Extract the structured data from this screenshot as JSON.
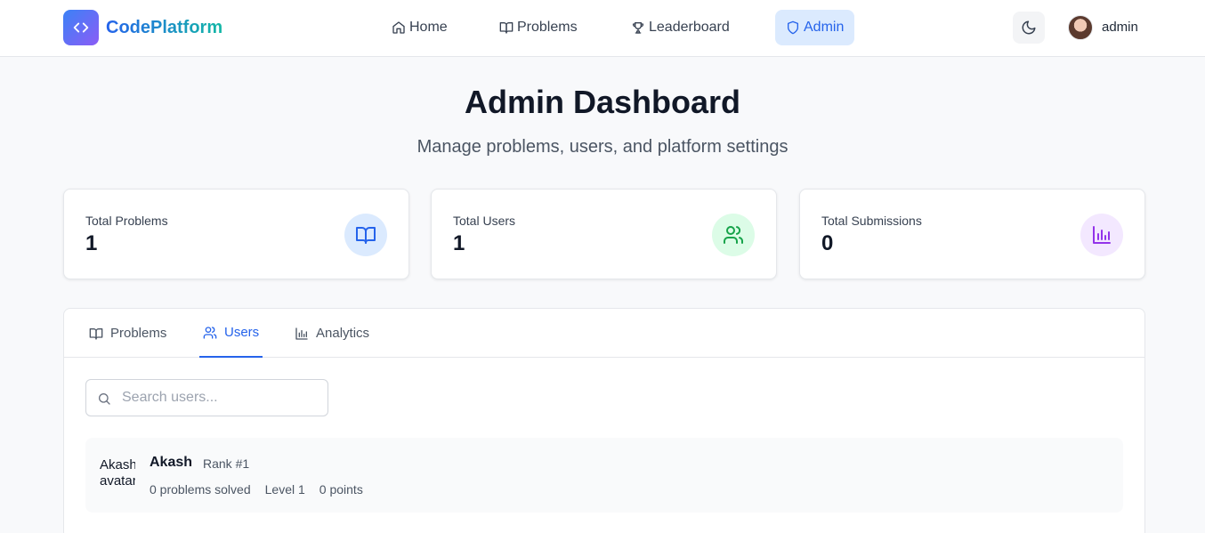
{
  "brand": {
    "name": "CodePlatform"
  },
  "nav": {
    "home": "Home",
    "problems": "Problems",
    "leaderboard": "Leaderboard",
    "admin": "Admin"
  },
  "user": {
    "name": "admin"
  },
  "page": {
    "title": "Admin Dashboard",
    "subtitle": "Manage problems, users, and platform settings"
  },
  "stats": [
    {
      "label": "Total Problems",
      "value": "1",
      "icon": "book-open-icon",
      "color": "#2563eb",
      "bg": "#dbeafe"
    },
    {
      "label": "Total Users",
      "value": "1",
      "icon": "users-icon",
      "color": "#16a34a",
      "bg": "#dcfce7"
    },
    {
      "label": "Total Submissions",
      "value": "0",
      "icon": "bar-chart-icon",
      "color": "#9333ea",
      "bg": "#f3e8ff"
    }
  ],
  "tabs": {
    "problems": "Problems",
    "users": "Users",
    "analytics": "Analytics",
    "active": "Users"
  },
  "search": {
    "placeholder": "Search users...",
    "value": ""
  },
  "users": [
    {
      "avatar_alt": "Akash's avatar",
      "name": "Akash",
      "rank": "Rank #1",
      "solved": "0 problems solved",
      "level": "Level 1",
      "points": "0 points"
    }
  ],
  "colors": {
    "accent": "#2563eb",
    "background": "#f8f9fb"
  }
}
